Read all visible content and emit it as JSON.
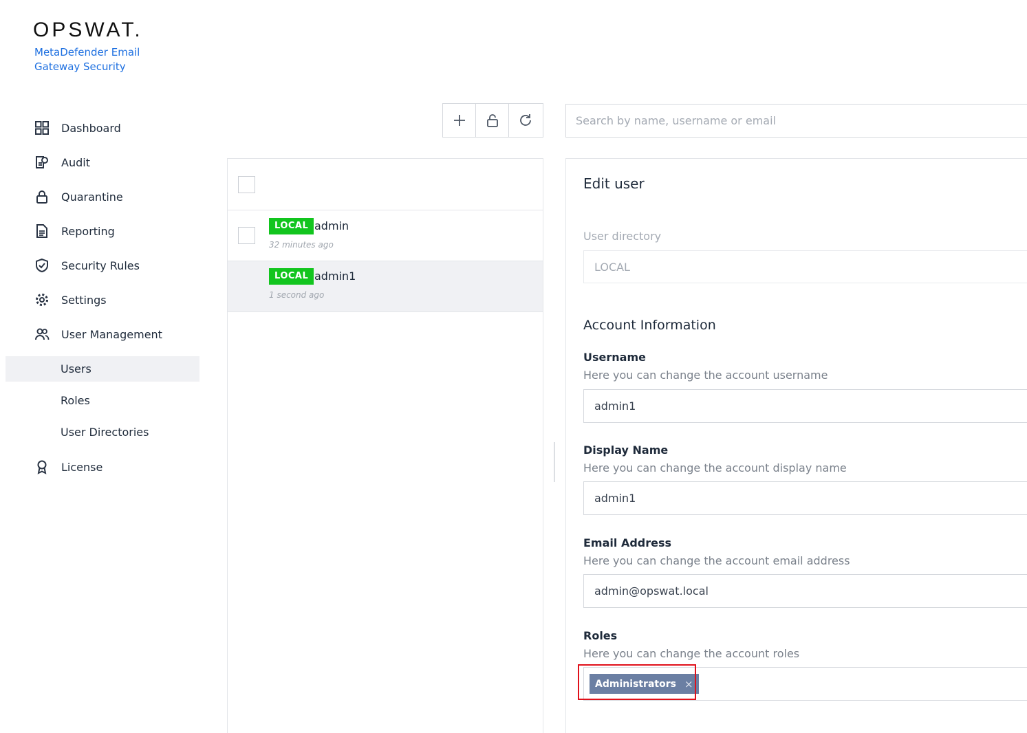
{
  "brand": {
    "logo": "OPSWAT.",
    "product_line1": "MetaDefender Email",
    "product_line2": "Gateway Security"
  },
  "nav": {
    "items": [
      {
        "label": "Dashboard",
        "icon": "dashboard-grid-icon"
      },
      {
        "label": "Audit",
        "icon": "audit-icon"
      },
      {
        "label": "Quarantine",
        "icon": "lock-icon"
      },
      {
        "label": "Reporting",
        "icon": "document-icon"
      },
      {
        "label": "Security Rules",
        "icon": "shield-check-icon"
      },
      {
        "label": "Settings",
        "icon": "gear-icon"
      },
      {
        "label": "User Management",
        "icon": "users-icon"
      }
    ],
    "sub_items": [
      {
        "label": "Users",
        "active": true
      },
      {
        "label": "Roles",
        "active": false
      },
      {
        "label": "User Directories",
        "active": false
      }
    ],
    "license": {
      "label": "License",
      "icon": "badge-award-icon"
    }
  },
  "toolbar": {
    "buttons": [
      "plus-icon",
      "unlock-icon",
      "refresh-icon"
    ]
  },
  "search": {
    "placeholder": "Search by name, username or email"
  },
  "users": [
    {
      "badge": "LOCAL",
      "name": "admin",
      "time": "32 minutes ago",
      "selected": false
    },
    {
      "badge": "LOCAL",
      "name": "admin1",
      "time": "1 second ago",
      "selected": true
    }
  ],
  "edit": {
    "title": "Edit user",
    "directory_label": "User directory",
    "directory_value": "LOCAL",
    "account_section": "Account Information",
    "username": {
      "label": "Username",
      "desc": "Here you can change the account username",
      "value": "admin1"
    },
    "display_name": {
      "label": "Display Name",
      "desc": "Here you can change the account display name",
      "value": "admin1"
    },
    "email": {
      "label": "Email Address",
      "desc": "Here you can change the account email address",
      "value": "admin@opswat.local"
    },
    "roles": {
      "label": "Roles",
      "desc": "Here you can change the account roles",
      "tags": [
        "Administrators"
      ]
    }
  },
  "colors": {
    "local_badge": "#12c51e",
    "brand_blue": "#1d6fe0",
    "role_tag": "#6b7fa3",
    "highlight": "#e0101a"
  }
}
